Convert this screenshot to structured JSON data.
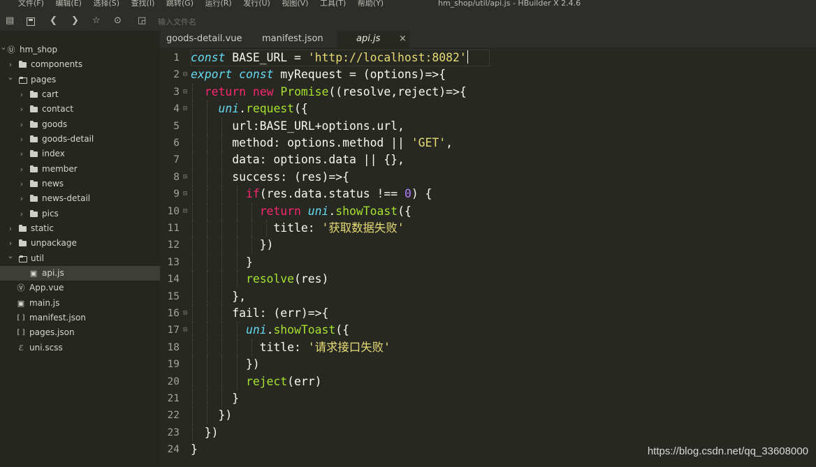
{
  "menubar": {
    "items": [
      "文件(F)",
      "编辑(E)",
      "选择(S)",
      "查找(I)",
      "跳转(G)",
      "运行(R)",
      "发行(U)",
      "视图(V)",
      "工具(T)",
      "帮助(Y)"
    ],
    "window_title": "hm_shop/util/api.js - HBuilder X 2.4.6"
  },
  "toolbar": {
    "file_search_placeholder": "输入文件名"
  },
  "sidebar": {
    "items": [
      {
        "label": "hm_shop",
        "type": "project"
      },
      {
        "label": "components",
        "type": "folder"
      },
      {
        "label": "pages",
        "type": "folder-open"
      },
      {
        "label": "cart",
        "type": "folder"
      },
      {
        "label": "contact",
        "type": "folder"
      },
      {
        "label": "goods",
        "type": "folder"
      },
      {
        "label": "goods-detail",
        "type": "folder"
      },
      {
        "label": "index",
        "type": "folder"
      },
      {
        "label": "member",
        "type": "folder"
      },
      {
        "label": "news",
        "type": "folder"
      },
      {
        "label": "news-detail",
        "type": "folder"
      },
      {
        "label": "pics",
        "type": "folder"
      },
      {
        "label": "static",
        "type": "folder"
      },
      {
        "label": "unpackage",
        "type": "folder"
      },
      {
        "label": "util",
        "type": "folder-open"
      },
      {
        "label": "api.js",
        "type": "js-file"
      },
      {
        "label": "App.vue",
        "type": "vue-file"
      },
      {
        "label": "main.js",
        "type": "js-file"
      },
      {
        "label": "manifest.json",
        "type": "json-file"
      },
      {
        "label": "pages.json",
        "type": "json-file"
      },
      {
        "label": "uni.scss",
        "type": "scss-file"
      }
    ],
    "selected": "api.js"
  },
  "tabs": [
    {
      "label": "goods-detail.vue",
      "active": false
    },
    {
      "label": "manifest.json",
      "active": false
    },
    {
      "label": "api.js",
      "active": true,
      "close": "×"
    }
  ],
  "editor": {
    "lines": [
      "const BASE_URL = 'http://localhost:8082'",
      "export const myRequest = (options)=>{",
      "  return new Promise((resolve,reject)=>{",
      "    uni.request({",
      "      url:BASE_URL+options.url,",
      "      method: options.method || 'GET',",
      "      data: options.data || {},",
      "      success: (res)=>{",
      "        if(res.data.status !== 0) {",
      "          return uni.showToast({",
      "            title: '获取数据失败'",
      "          })",
      "        }",
      "        resolve(res)",
      "      },",
      "      fail: (err)=>{",
      "        uni.showToast({",
      "          title: '请求接口失败'",
      "        })",
      "        reject(err)",
      "      }",
      "    })",
      "  })",
      "}"
    ],
    "line_numbers": [
      "1",
      "2",
      "3",
      "4",
      "5",
      "6",
      "7",
      "8",
      "9",
      "10",
      "11",
      "12",
      "13",
      "14",
      "15",
      "16",
      "17",
      "18",
      "19",
      "20",
      "21",
      "22",
      "23",
      "24"
    ],
    "foldable_lines": [
      2,
      3,
      4,
      8,
      9,
      10,
      16,
      17
    ]
  },
  "watermark": "https://blog.csdn.net/qq_33608000",
  "colors": {
    "background": "#272822",
    "keyword_blue": "#66d9ef",
    "keyword_pink": "#f92672",
    "function_green": "#a6e22e",
    "string_yellow": "#e6db74",
    "number_purple": "#ae81ff"
  }
}
